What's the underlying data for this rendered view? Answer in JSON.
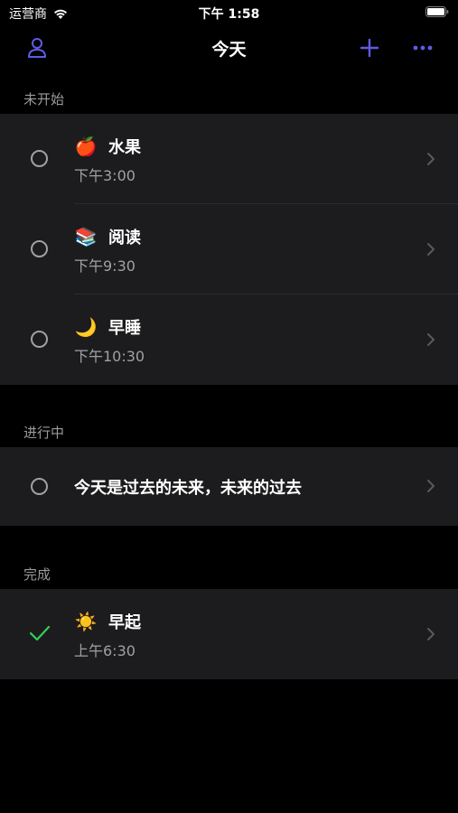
{
  "status_bar": {
    "carrier": "运营商",
    "time": "下午 1:58"
  },
  "navbar": {
    "title": "今天",
    "profile_icon": "person-icon",
    "add_icon": "plus-icon",
    "more_icon": "ellipsis-icon"
  },
  "colors": {
    "accent": "#5e5ce6",
    "background": "#000000",
    "group_bg": "#1c1c1e",
    "secondary_text": "#9a9a9f",
    "success": "#30d158"
  },
  "sections": {
    "not_started": {
      "header": "未开始",
      "items": [
        {
          "emoji": "🍎",
          "title": "水果",
          "time": "下午3:00",
          "done": false
        },
        {
          "emoji": "📚",
          "title": "阅读",
          "time": "下午9:30",
          "done": false
        },
        {
          "emoji": "🌙",
          "title": "早睡",
          "time": "下午10:30",
          "done": false
        }
      ]
    },
    "in_progress": {
      "header": "进行中",
      "items": [
        {
          "title": "今天是过去的未来，未来的过去",
          "done": false
        }
      ]
    },
    "done": {
      "header": "完成",
      "items": [
        {
          "emoji": "☀️",
          "title": "早起",
          "time": "上午6:30",
          "done": true
        }
      ]
    }
  }
}
